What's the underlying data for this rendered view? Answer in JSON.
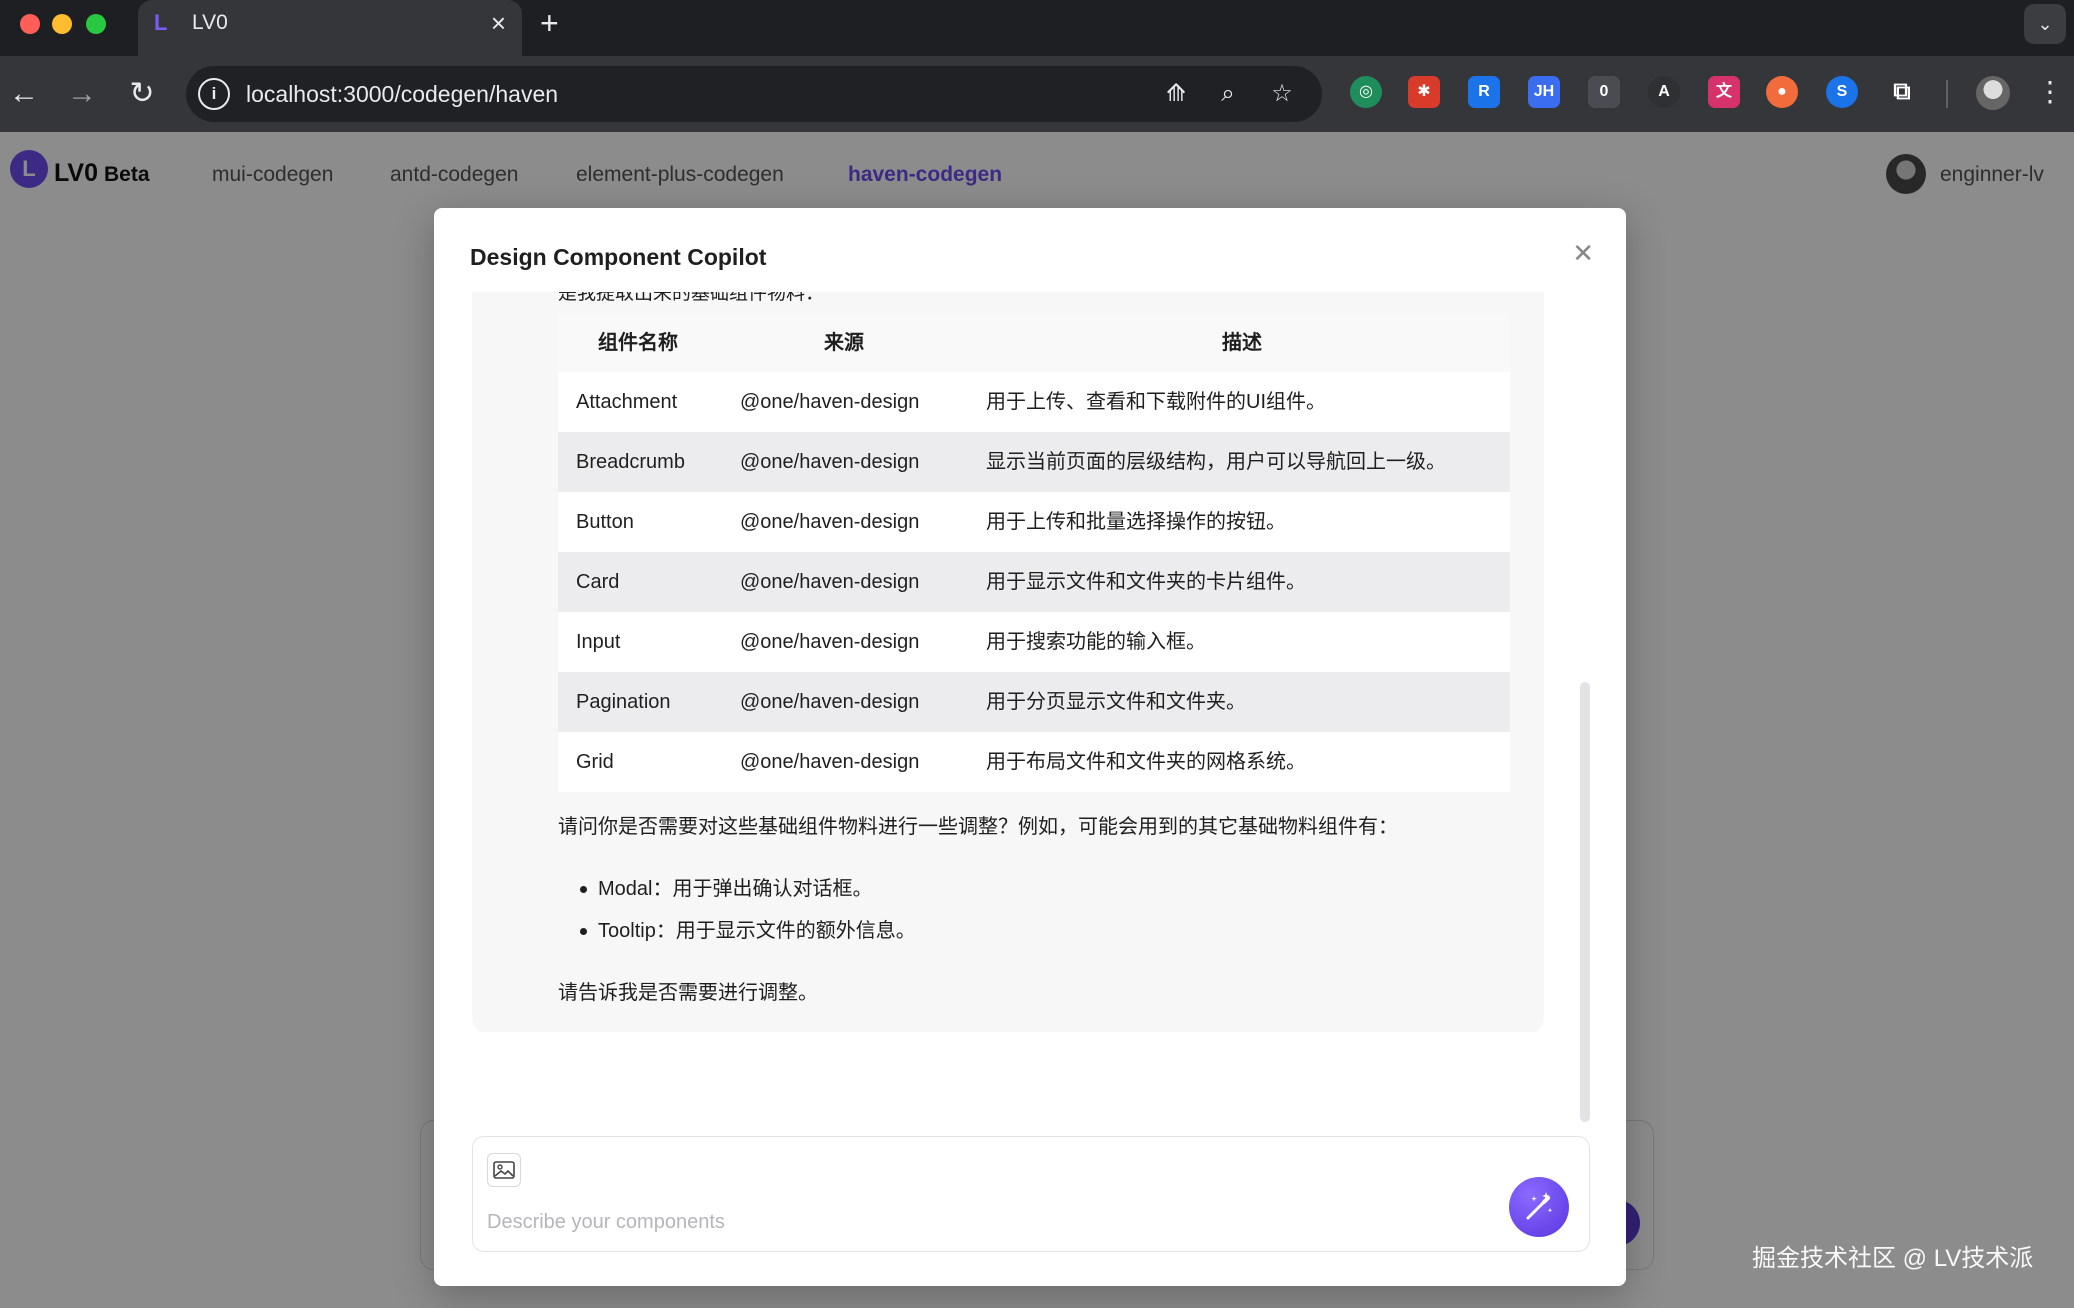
{
  "browser": {
    "tab_title": "LV0",
    "tab_favicon": "L",
    "url": "localhost:3000/codegen/haven",
    "extension_badge": "0"
  },
  "app": {
    "logo": "LV0",
    "logo_badge": "Beta",
    "nav": [
      "mui-codegen",
      "antd-codegen",
      "element-plus-codegen",
      "haven-codegen"
    ],
    "active_nav": "haven-codegen",
    "user": "enginner-lv"
  },
  "modal": {
    "title": "Design Component Copilot",
    "cut_text": "是我提取出来的基础组件物料：",
    "table": {
      "headers": [
        "组件名称",
        "来源",
        "描述"
      ],
      "rows": [
        [
          "Attachment",
          "@one/haven-design",
          "用于上传、查看和下载附件的UI组件。"
        ],
        [
          "Breadcrumb",
          "@one/haven-design",
          "显示当前页面的层级结构，用户可以导航回上一级。"
        ],
        [
          "Button",
          "@one/haven-design",
          "用于上传和批量选择操作的按钮。"
        ],
        [
          "Card",
          "@one/haven-design",
          "用于显示文件和文件夹的卡片组件。"
        ],
        [
          "Input",
          "@one/haven-design",
          "用于搜索功能的输入框。"
        ],
        [
          "Pagination",
          "@one/haven-design",
          "用于分页显示文件和文件夹。"
        ],
        [
          "Grid",
          "@one/haven-design",
          "用于布局文件和文件夹的网格系统。"
        ]
      ]
    },
    "follow_up": "请问你是否需要对这些基础组件物料进行一些调整？例如，可能会用到的其它基础物料组件有：",
    "suggestions": [
      "Modal：用于弹出确认对话框。",
      "Tooltip：用于显示文件的额外信息。"
    ],
    "closing": "请告诉我是否需要进行调整。",
    "input_placeholder": "Describe your components"
  },
  "watermark": "掘金技术社区 @ LV技术派",
  "colors": {
    "accent": "#6f4ef2",
    "row_alt": "#ececee",
    "bubble": "#f7f7f8"
  }
}
